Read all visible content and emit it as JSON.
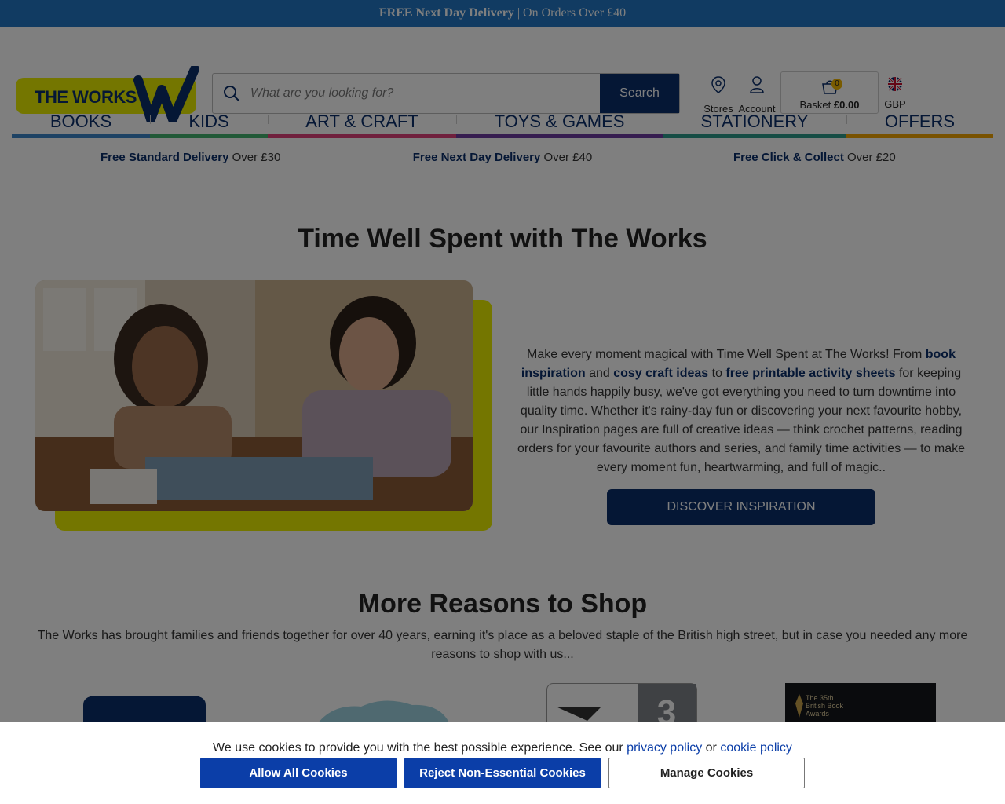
{
  "topbar": {
    "bold": "FREE Next Day Delivery",
    "rest": " | On Orders Over £40"
  },
  "header": {
    "logo_text": "THE WORKS",
    "search_placeholder": "What are you looking for?",
    "search_button": "Search",
    "stores_label": "Stores",
    "account_label": "Account",
    "basket_label": "Basket",
    "basket_total": "£0.00",
    "basket_count": "0",
    "currency": "GBP"
  },
  "nav": [
    {
      "label": "BOOKS",
      "color": "#3a85c9"
    },
    {
      "label": "KIDS",
      "color": "#43b36e"
    },
    {
      "label": "ART & CRAFT",
      "color": "#e0417a"
    },
    {
      "label": "TOYS & GAMES",
      "color": "#6d3aa0"
    },
    {
      "label": "STATIONERY",
      "color": "#2d9a8a"
    },
    {
      "label": "OFFERS",
      "color": "#f2a500"
    }
  ],
  "usp": [
    {
      "bold": "Free Standard Delivery",
      "rest": " Over £30"
    },
    {
      "bold": "Free Next Day Delivery",
      "rest": " Over £40"
    },
    {
      "bold": "Free Click & Collect",
      "rest": " Over £20"
    }
  ],
  "hero": {
    "title": "Time Well Spent with The Works",
    "p1": "Make every moment magical with Time Well Spent at The Works! From ",
    "l1": "book inspiration",
    "p2": " and ",
    "l2": "cosy craft ideas",
    "p3": " to ",
    "l3": "free printable activity sheets",
    "p4": " for keeping little hands happily busy, we've got everything you need to turn downtime into quality time. Whether it's rainy-day fun or discovering your next favourite hobby, our Inspiration pages are full of creative ideas — think crochet patterns, reading orders for your favourite authors and series, and family time activities — to make every moment fun, heartwarming, and full of magic..",
    "cta": "DISCOVER INSPIRATION"
  },
  "reasons": {
    "title": "More Reasons to Shop",
    "sub": "The Works has brought families and friends together for over 40 years, earning it's place as a beloved staple of the British high street, but in case you needed any more reasons to shop with us...",
    "award_text": "The 35th British Book Awards",
    "tile_number": "3"
  },
  "cookie": {
    "msg1": "We use cookies to provide you with the best possible experience. See our ",
    "privacy": "privacy policy",
    "or": " or ",
    "cookie_policy": "cookie policy",
    "allow": "Allow All Cookies",
    "reject": "Reject Non-Essential Cookies",
    "manage": "Manage Cookies"
  }
}
